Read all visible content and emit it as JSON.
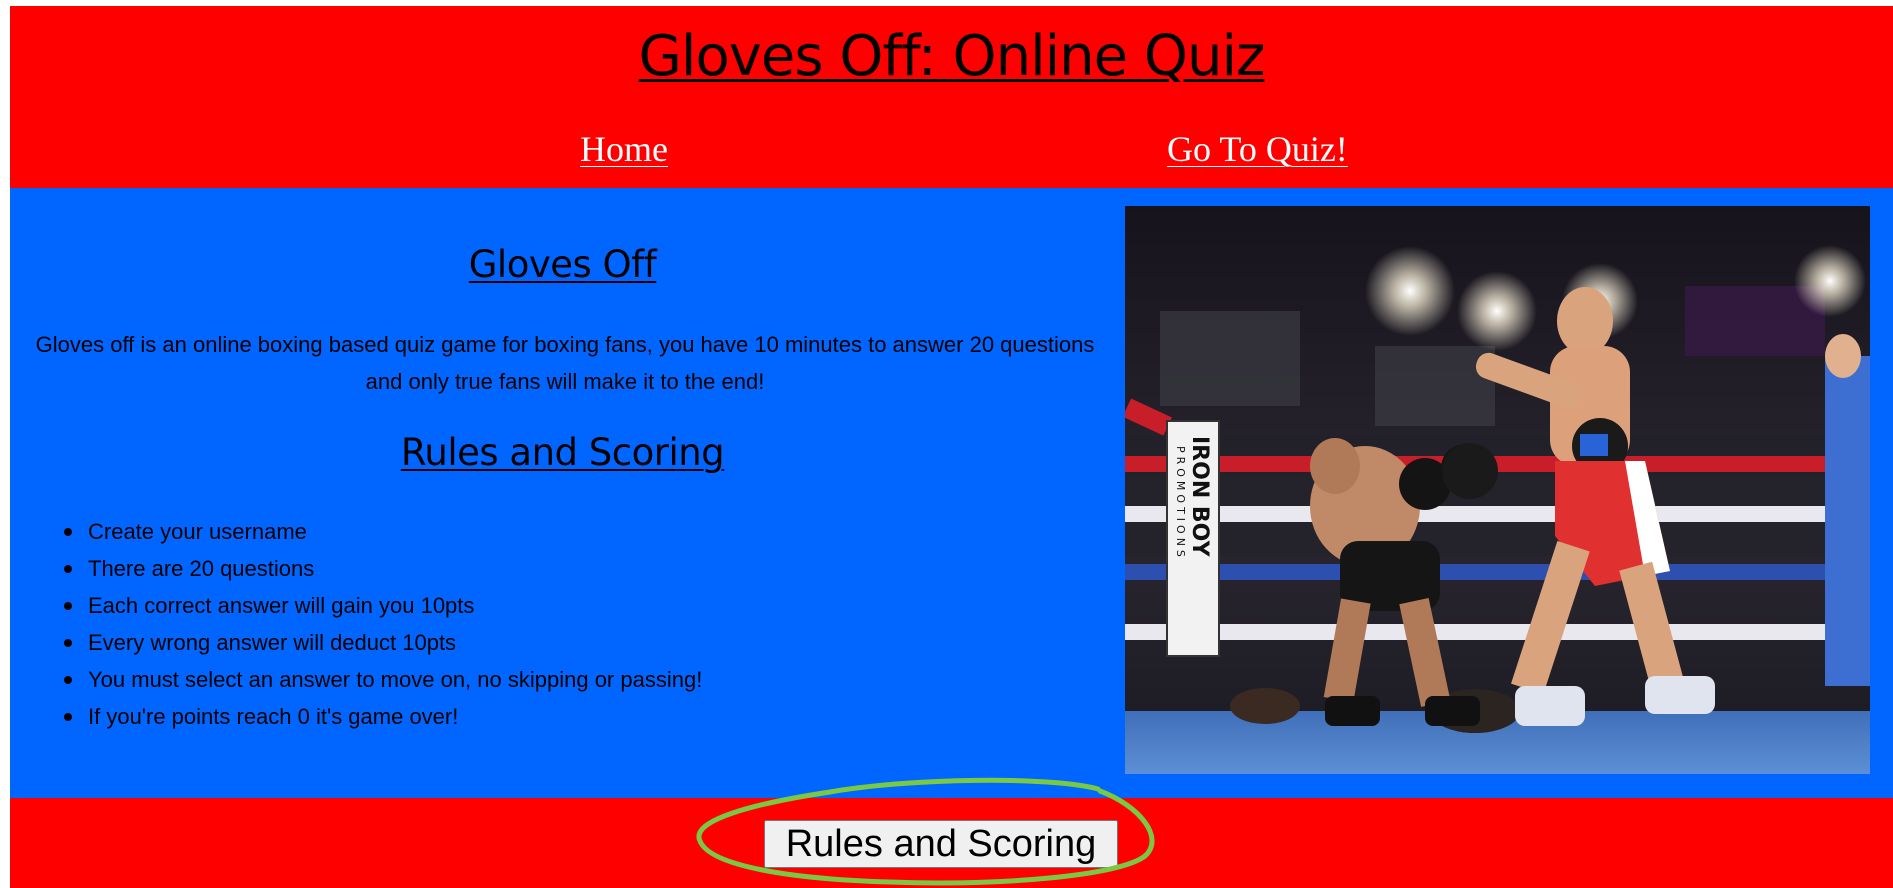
{
  "header": {
    "title": "Gloves Off: Online Quiz",
    "nav": [
      {
        "label": "Home"
      },
      {
        "label": "Go To Quiz!"
      }
    ]
  },
  "main": {
    "about_heading": "Gloves Off",
    "about_text": "Gloves off is an online boxing based quiz game for boxing fans, you have 10 minutes to answer 20 questions and only true fans will make it to the end!",
    "rules_heading": "Rules and Scoring",
    "rules": [
      "Create your username",
      "There are 20 questions",
      "Each correct answer will gain you 10pts",
      "Every wrong answer will deduct 10pts",
      "You must select an answer to move on, no skipping or passing!",
      "If you're points reach 0 it's game over!"
    ],
    "hero_image": {
      "ring_text": [
        "IRON BOY",
        "PROMOTIONS"
      ]
    }
  },
  "footer": {
    "button_label": "Rules and Scoring"
  },
  "colors": {
    "header_bg": "#ff0000",
    "main_bg": "#0066ff",
    "footer_bg": "#ff0000",
    "annotation": "#7ac943"
  }
}
